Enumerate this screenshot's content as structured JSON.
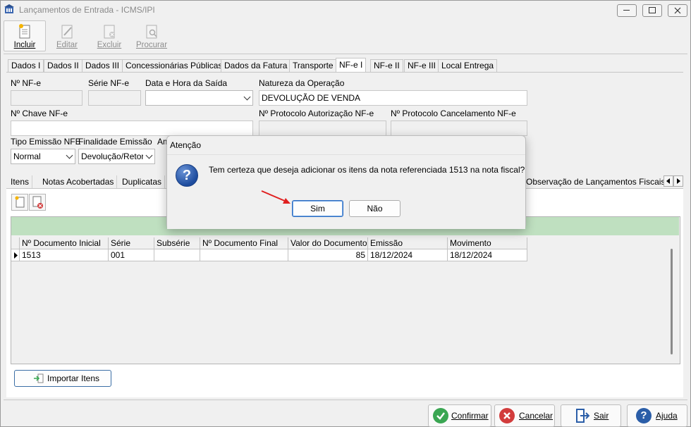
{
  "window": {
    "title": "Lançamentos de Entrada - ICMS/IPI"
  },
  "toolbar": {
    "incluir": "Incluir",
    "editar": "Editar",
    "excluir": "Excluir",
    "procurar": "Procurar"
  },
  "tabs": [
    "Dados I",
    "Dados II",
    "Dados III",
    "Concessionárias Públicas",
    "Dados da Fatura",
    "Transporte",
    "NF-e I",
    "NF-e II",
    "NF-e III",
    "Local Entrega"
  ],
  "form": {
    "nf_label": "Nº NF-e",
    "serie_label": "Série NF-e",
    "data_saida_label": "Data e Hora da Saída",
    "natureza_label": "Natureza da Operação",
    "natureza_value": "DEVOLUÇÃO DE VENDA",
    "chave_label": "Nº Chave NF-e",
    "prot_aut_label": "Nº Protocolo Autorização NF-e",
    "prot_canc_label": "Nº Protocolo Cancelamento NF-e",
    "tipo_emissao_label": "Tipo Emissão NFE",
    "tipo_emissao_value": "Normal",
    "finalidade_label": "Finalidade Emissão",
    "finalidade_value": "Devolução/Retor",
    "amb_label": "Am"
  },
  "subtabs": [
    "Itens",
    "Notas Acobertadas",
    "Duplicatas",
    "Observação de Lançamentos Fiscais (C"
  ],
  "grid": {
    "headers": [
      "Nº Documento Inicial",
      "Série",
      "Subsérie",
      "Nº Documento Final",
      "Valor do Documento",
      "Emissão",
      "Movimento"
    ],
    "rows": [
      [
        "1513",
        "001",
        "",
        "",
        "85",
        "18/12/2024",
        "18/12/2024"
      ]
    ]
  },
  "import_button": "Importar Itens",
  "bottom": {
    "confirmar": "Confirmar",
    "cancelar": "Cancelar",
    "sair": "Sair",
    "ajuda": "Ajuda"
  },
  "dialog": {
    "title": "Atenção",
    "message": "Tem certeza que deseja adicionar os itens da nota referenciada 1513 na nota fiscal?",
    "yes": "Sim",
    "no": "Não"
  },
  "colors": {
    "accent": "#2f6ec1",
    "grid_band": "#bfe0c0",
    "confirm": "#3aa652",
    "cancel": "#d23c3c",
    "help": "#2b5ea8"
  }
}
